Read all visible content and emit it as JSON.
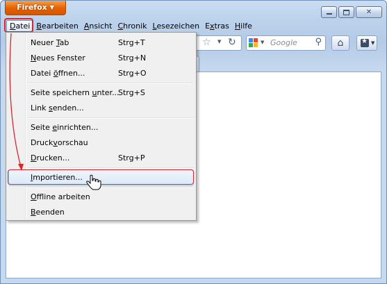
{
  "app": {
    "button_label": "Firefox",
    "button_arrow": "▼"
  },
  "menubar": {
    "items": [
      {
        "pre": "",
        "acc": "D",
        "post": "atei"
      },
      {
        "pre": "",
        "acc": "B",
        "post": "earbeiten"
      },
      {
        "pre": "",
        "acc": "A",
        "post": "nsicht"
      },
      {
        "pre": "",
        "acc": "C",
        "post": "hronik"
      },
      {
        "pre": "",
        "acc": "L",
        "post": "esezeichen"
      },
      {
        "pre": "E",
        "acc": "x",
        "post": "tras"
      },
      {
        "pre": "",
        "acc": "H",
        "post": "ilfe"
      }
    ]
  },
  "toolbar": {
    "search_placeholder": "Google",
    "icons": [
      "star-icon",
      "reload-icon",
      "google-icon",
      "search-icon",
      "home-icon",
      "bookmarks-icon"
    ]
  },
  "file_menu": {
    "items": [
      {
        "pre": "Neuer ",
        "acc": "T",
        "post": "ab",
        "shortcut": "Strg+T"
      },
      {
        "pre": "",
        "acc": "N",
        "post": "eues Fenster",
        "shortcut": "Strg+N"
      },
      {
        "pre": "Datei ",
        "acc": "ö",
        "post": "ffnen...",
        "shortcut": "Strg+O"
      },
      {
        "pre": "Seite speichern ",
        "acc": "u",
        "post": "nter...",
        "shortcut": "Strg+S"
      },
      {
        "pre": "Link ",
        "acc": "s",
        "post": "enden...",
        "shortcut": ""
      },
      {
        "pre": "Seite ",
        "acc": "e",
        "post": "inrichten...",
        "shortcut": ""
      },
      {
        "pre": "Druck",
        "acc": "v",
        "post": "orschau",
        "shortcut": ""
      },
      {
        "pre": "",
        "acc": "D",
        "post": "rucken...",
        "shortcut": "Strg+P"
      },
      {
        "pre": "",
        "acc": "I",
        "post": "mportieren...",
        "shortcut": ""
      },
      {
        "pre": "",
        "acc": "O",
        "post": "ffline arbeiten",
        "shortcut": ""
      },
      {
        "pre": "",
        "acc": "B",
        "post": "eenden",
        "shortcut": ""
      }
    ]
  },
  "colors": {
    "annotation": "#d8242c",
    "firefox_orange": "#e66000"
  }
}
